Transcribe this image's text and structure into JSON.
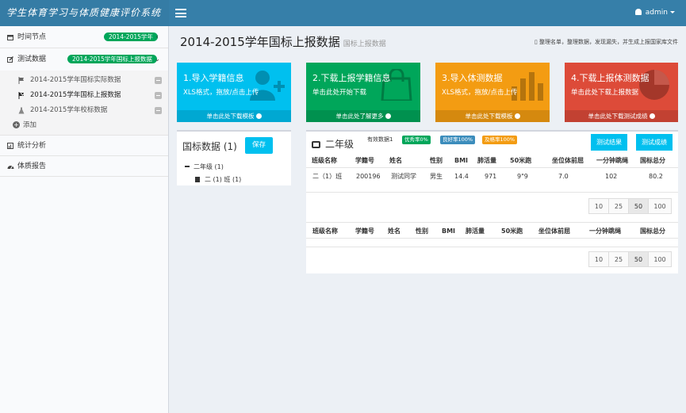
{
  "app": {
    "title": "学生体育学习与体质健康评价系统"
  },
  "user": {
    "name": "admin"
  },
  "sidebar": {
    "time_node": {
      "label": "时间节点",
      "badge": "2014-2015学年"
    },
    "test_data": {
      "label": "测试数据",
      "badge": "2014-2015学年国标上报数据"
    },
    "sub_items": [
      {
        "label": "2014-2015学年国标实际数据"
      },
      {
        "label": "2014-2015学年国标上报数据"
      },
      {
        "label": "2014-2015学年校标数据"
      }
    ],
    "add_label": "添加",
    "stats": {
      "label": "统计分析"
    },
    "report": {
      "label": "体质报告"
    }
  },
  "page": {
    "title": "2014-2015学年国标上报数据",
    "subtitle": "国标上报数据",
    "breadcrumb": "整理名单，整理数据，发现漏失，并生成上报国家库文件"
  },
  "tiles": [
    {
      "title": "1.导入学籍信息",
      "desc": "XLS格式，拖放/点击上传",
      "footer": "单击此处下载模板",
      "color": "#00c0ef"
    },
    {
      "title": "2.下载上报学籍信息",
      "desc": "单击此处开始下载",
      "footer": "单击此处了解更多",
      "color": "#00a65a"
    },
    {
      "title": "3.导入体测数据",
      "desc": "XLS格式，拖放/点击上传",
      "footer": "单击此处下载模板",
      "color": "#f39c12"
    },
    {
      "title": "4.下载上报体测数据",
      "desc": "单击此处下载上报数据",
      "footer": "单击此处下载测试成绩",
      "color": "#dd4b39"
    }
  ],
  "tree_box": {
    "title": "国标数据 (1)",
    "save_label": "保存",
    "grade": "二年级 (1)",
    "class": "二 (1) 班 (1)"
  },
  "data_box": {
    "title": "二年级",
    "valid_label": "有效数据1",
    "labels": [
      {
        "text": "优秀率0%",
        "color": "#00a65a"
      },
      {
        "text": "良好率100%",
        "color": "#3c8dbc"
      },
      {
        "text": "及格率100%",
        "color": "#f39c12"
      }
    ],
    "buttons": [
      "测试结果",
      "测试成绩"
    ],
    "columns": [
      "班级名称",
      "学籍号",
      "姓名",
      "性别",
      "BMI",
      "肺活量",
      "50米跑",
      "坐位体前屈",
      "一分钟跳绳",
      "国标总分"
    ],
    "rows": [
      [
        "二（1）班",
        "200196",
        "测试同学",
        "男生",
        "14.4",
        "971",
        "9\"9",
        "7.0",
        "102",
        "80.2"
      ]
    ],
    "page_sizes": [
      "10",
      "25",
      "50",
      "100"
    ],
    "active_page_size": "50"
  }
}
